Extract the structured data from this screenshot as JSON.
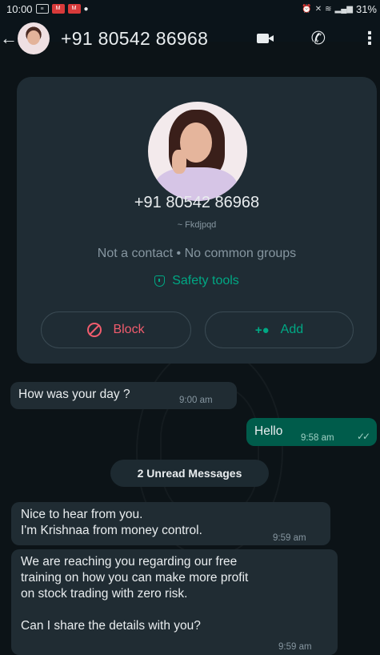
{
  "status_bar": {
    "time": "10:00",
    "battery": "31%"
  },
  "header": {
    "title": "+91 80542 86968"
  },
  "contact_card": {
    "number": "+91 80542 86968",
    "pushname": "~ Fkdjpqd",
    "meta": "Not a contact • No common groups",
    "safety_label": "Safety tools",
    "block_label": "Block",
    "add_label": "Add"
  },
  "messages": [
    {
      "direction": "incoming",
      "text": "How was your day ?",
      "time": "9:00 am"
    },
    {
      "direction": "outgoing",
      "text": "Hello",
      "time": "9:58 am"
    },
    {
      "direction": "incoming",
      "lines": [
        "Nice to hear from you.",
        "I'm Krishnaa from money control."
      ],
      "time": "9:59 am"
    },
    {
      "direction": "incoming",
      "lines": [
        "We are reaching you regarding our free",
        "training on how you can make more profit",
        "on stock trading with zero risk.",
        "Can I share the details with you?"
      ],
      "time": "9:59 am"
    }
  ],
  "unread_label": "2 Unread Messages",
  "colors": {
    "background": "#0b141a",
    "incoming_bubble": "#202c33",
    "outgoing_bubble": "#005c4b",
    "accent": "#00a884",
    "danger": "#f15c6d"
  },
  "icons": [
    "back-arrow-icon",
    "video-call-icon",
    "voice-call-icon",
    "more-options-icon",
    "shield-icon",
    "block-icon",
    "add-contact-icon",
    "read-ticks-icon"
  ]
}
